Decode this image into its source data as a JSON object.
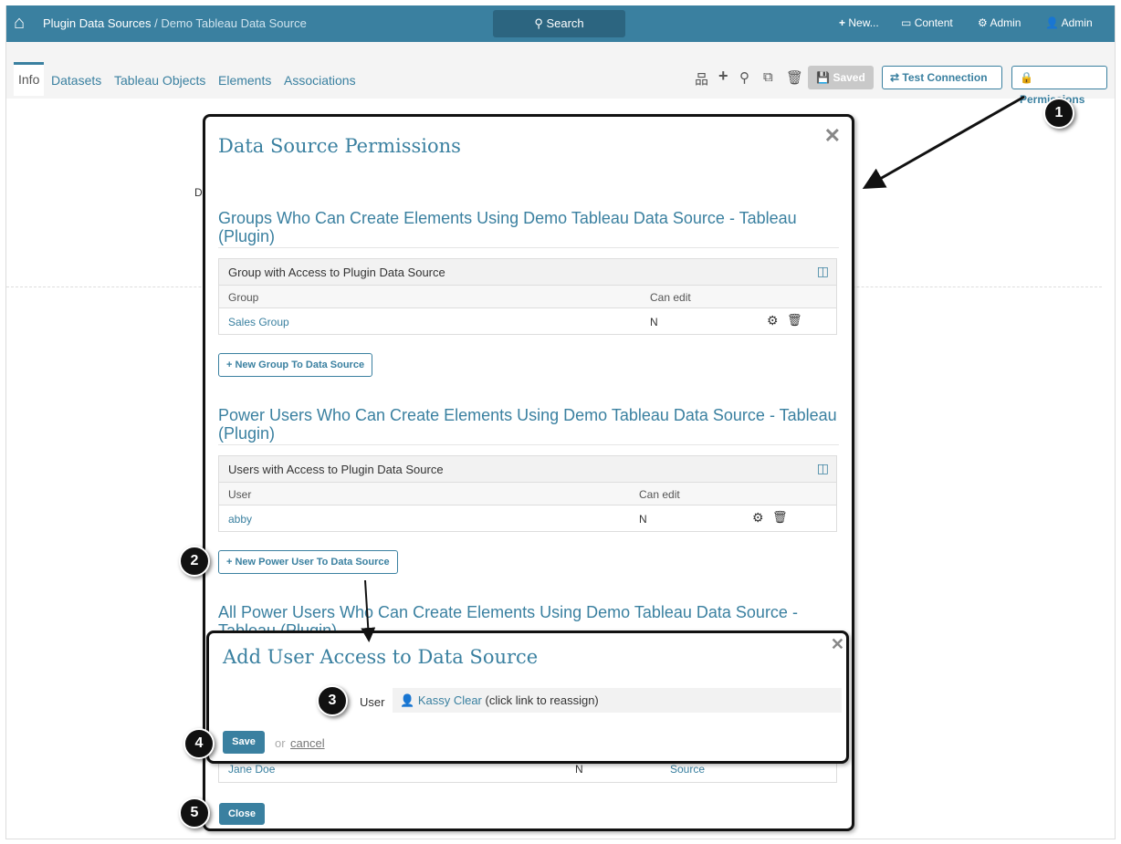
{
  "header": {
    "crumb_root": "Plugin Data Sources",
    "crumb_sep": " / ",
    "crumb_current": "Demo Tableau Data Source",
    "search": "Search",
    "nav": [
      "New...",
      "Content",
      "Admin",
      "Admin"
    ]
  },
  "tabs": [
    "Info",
    "Datasets",
    "Tableau Objects",
    "Elements",
    "Associations"
  ],
  "toolbar": {
    "saved": "Saved",
    "test_connection": "Test Connection",
    "permissions": "Permissions"
  },
  "background": {
    "partial_text": "D"
  },
  "modal": {
    "title": "Data Source Permissions",
    "groups": {
      "heading": "Groups Who Can Create Elements Using Demo Tableau Data Source - Tableau (Plugin)",
      "caption": "Group with Access to Plugin Data Source",
      "columns": [
        "Group",
        "Can edit"
      ],
      "rows": [
        {
          "name": "Sales Group",
          "can_edit": "N"
        }
      ],
      "new_button": "New Group To Data Source"
    },
    "power_users": {
      "heading": "Power Users Who Can Create Elements Using Demo Tableau Data Source - Tableau (Plugin)",
      "caption": "Users with Access to Plugin Data Source",
      "columns": [
        "User",
        "Can edit"
      ],
      "rows": [
        {
          "name": "abby",
          "can_edit": "N"
        }
      ],
      "new_button": "New Power User To Data Source"
    },
    "all_power_users": {
      "heading": "All Power Users Who Can Create Elements Using Demo Tableau Data Source - Tableau (Plugin)",
      "rows": [
        {
          "name": "Jane Doe",
          "can_edit": "N",
          "source": "Source"
        }
      ]
    },
    "close_button": "Close"
  },
  "sub_modal": {
    "title": "Add User Access to Data Source",
    "user_label": "User",
    "user_name": "Kassy Clear",
    "user_hint": " (click link to reassign)",
    "save": "Save",
    "or": "or",
    "cancel": "cancel"
  },
  "callouts": [
    "1",
    "2",
    "3",
    "4",
    "5"
  ]
}
